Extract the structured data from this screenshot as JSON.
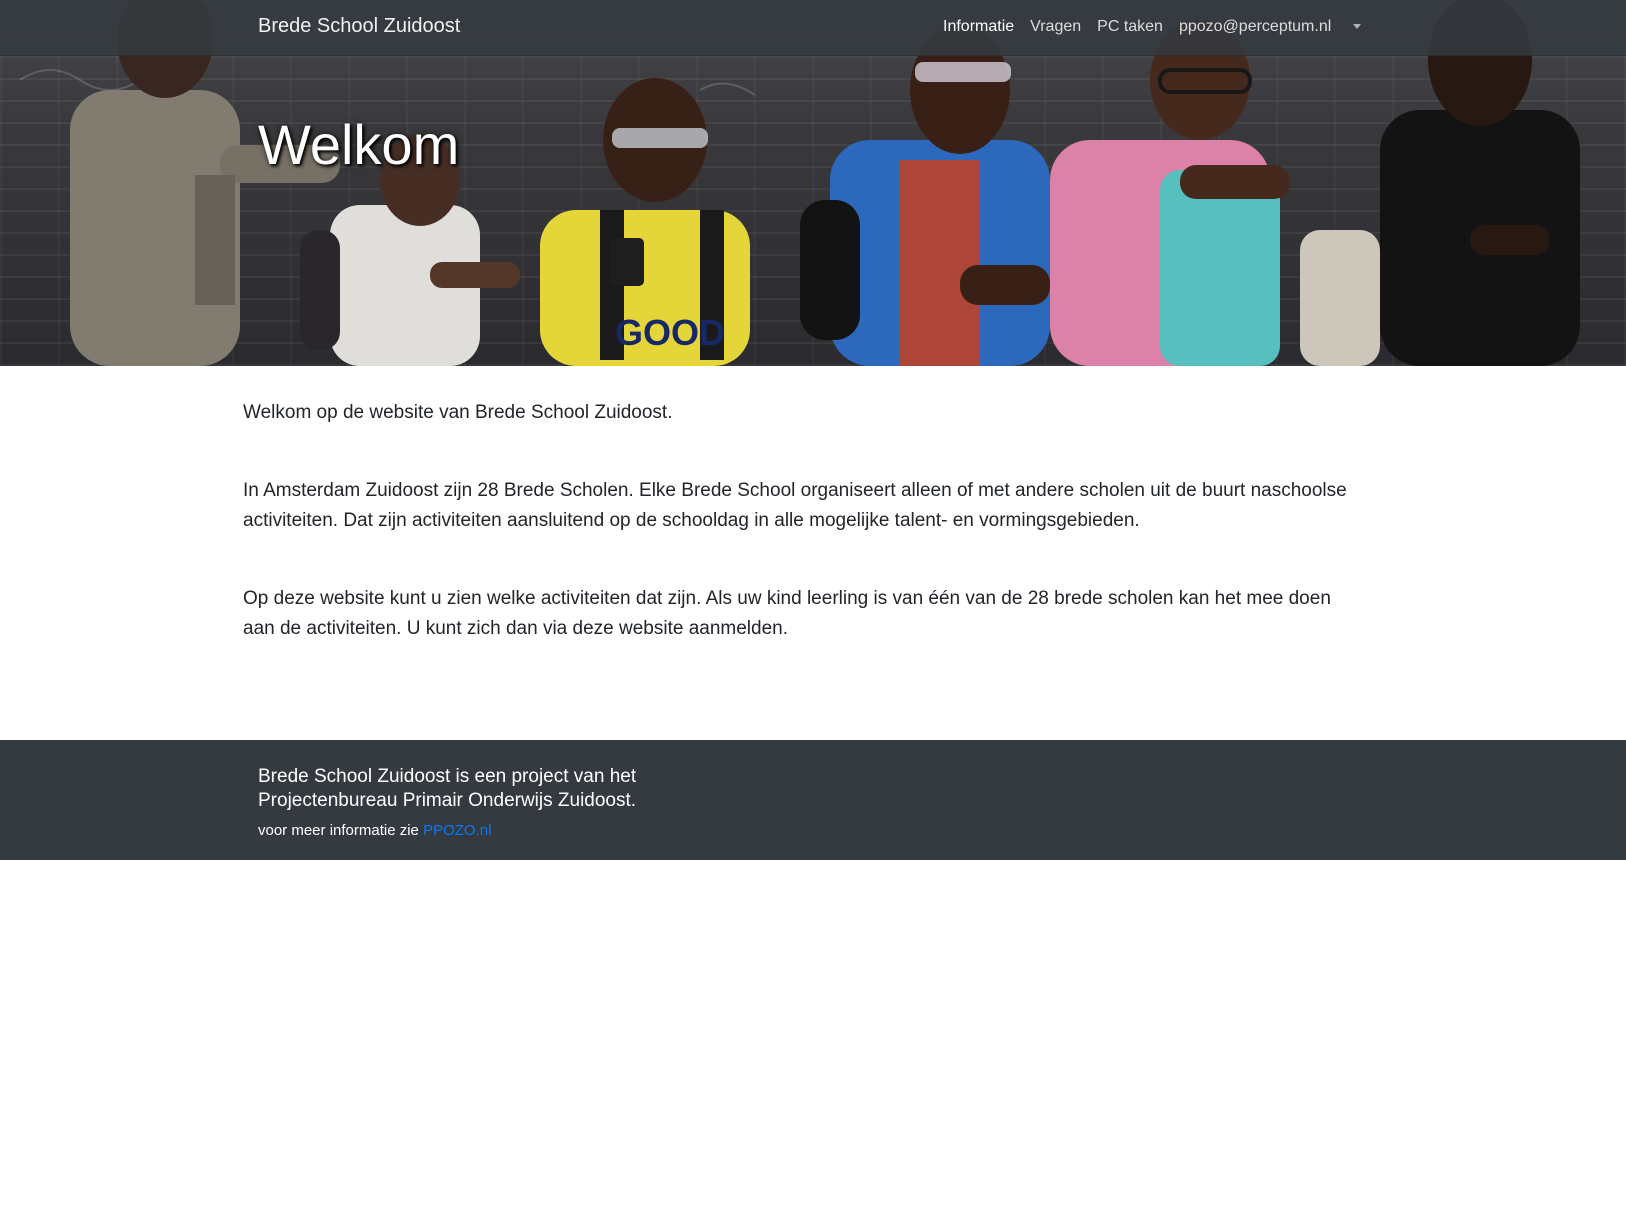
{
  "navbar": {
    "brand": "Brede School Zuidoost",
    "items": [
      {
        "label": "Informatie",
        "active": true
      },
      {
        "label": "Vragen",
        "active": false
      },
      {
        "label": "PC taken",
        "active": false
      },
      {
        "label": "ppozo@perceptum.nl",
        "active": false,
        "dropdown": true
      }
    ]
  },
  "hero": {
    "title": "Welkom",
    "image_icon": "children-photo-icon"
  },
  "main": {
    "paragraphs": [
      "Welkom op de website van Brede School Zuidoost.",
      "In Amsterdam Zuidoost zijn 28 Brede Scholen. Elke Brede School organiseert alleen of met andere scholen uit de buurt naschoolse activiteiten. Dat zijn activiteiten aansluitend op de schooldag in alle mogelijke talent- en vormingsgebieden.",
      "Op deze website kunt u zien welke activiteiten dat zijn. Als uw kind leerling is van één van de 28 brede scholen kan het mee doen aan de activiteiten. U kunt zich dan via deze website aanmelden."
    ]
  },
  "footer": {
    "title": "Brede School Zuidoost is een project van het Projectenbureau Primair Onderwijs Zuidoost.",
    "info_text": "voor meer informatie zie ",
    "link_label": "PPOZO.nl"
  },
  "colors": {
    "navbar_bg": "#343a40",
    "footer_bg": "#343a40",
    "link": "#007bff",
    "text": "#212529"
  }
}
